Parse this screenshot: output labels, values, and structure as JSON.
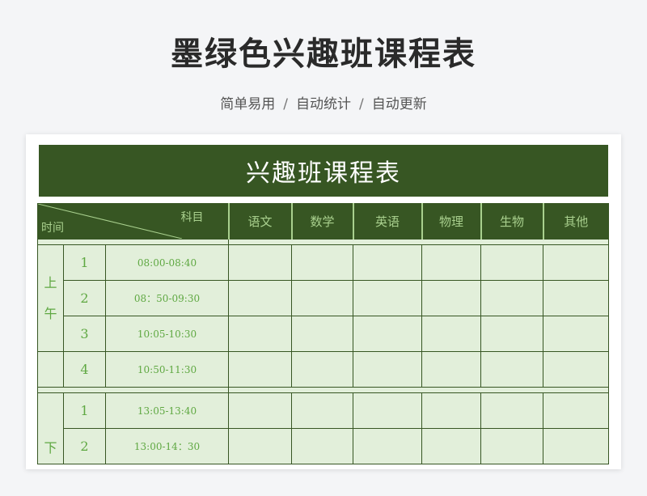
{
  "header": {
    "title": "墨绿色兴趣班课程表",
    "tags": [
      "简单易用",
      "自动统计",
      "自动更新"
    ],
    "separator": "/"
  },
  "sheet": {
    "title": "兴趣班课程表",
    "corner": {
      "subject_label": "科目",
      "time_label": "时间"
    },
    "subjects": [
      "语文",
      "数学",
      "英语",
      "物理",
      "生物",
      "其他"
    ],
    "morning": {
      "label_chars": [
        "上",
        "午"
      ],
      "periods": [
        {
          "num": "1",
          "time": "08:00-08:40"
        },
        {
          "num": "2",
          "time": "08：50-09:30"
        },
        {
          "num": "3",
          "time": "10:05-10:30"
        },
        {
          "num": "4",
          "time": "10:50-11:30"
        }
      ]
    },
    "afternoon": {
      "label_chars": [
        "下"
      ],
      "periods": [
        {
          "num": "1",
          "time": "13:05-13:40"
        },
        {
          "num": "2",
          "time": "13:00-14：30"
        }
      ]
    }
  },
  "colors": {
    "dark_green": "#375623",
    "light_green": "#e2efda",
    "text_green": "#5fa842",
    "header_text": "#a9d08e"
  }
}
